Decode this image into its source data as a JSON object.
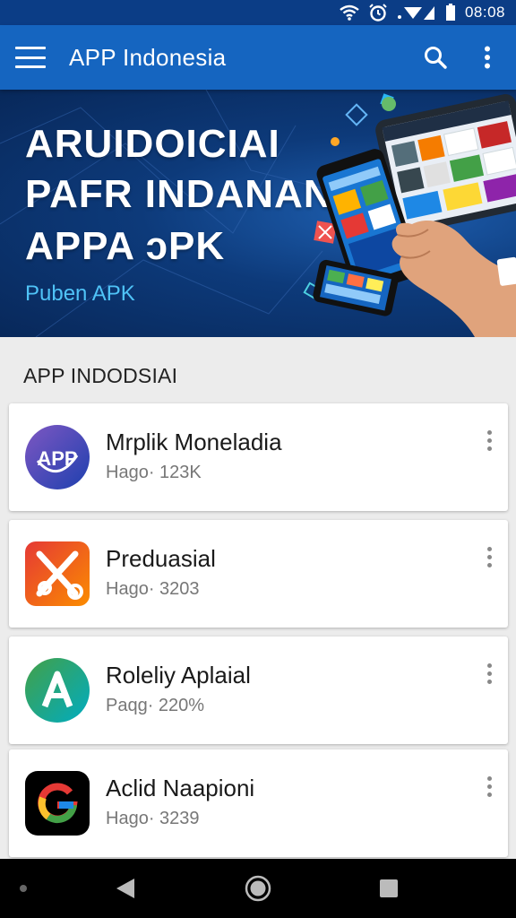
{
  "status_bar": {
    "time": "08:08",
    "icons": [
      "wifi-icon",
      "alarm-icon",
      "signal-icon",
      "battery-icon"
    ]
  },
  "app_bar": {
    "title": "APP  Indonesia",
    "icons": [
      "menu-icon",
      "search-icon",
      "more-vert-icon"
    ],
    "color": "#1565c0"
  },
  "banner": {
    "line1": "ARUIDOICIAI",
    "line2": "PAFR INDANAN",
    "line3": "APPA ɔPK",
    "subtitle": "Puben APK"
  },
  "section": {
    "title": "APP INDODSIAI"
  },
  "apps": [
    {
      "name": "Mrplik Moneladia",
      "meta": "Hago· 123K",
      "icon": "app-logo-icon"
    },
    {
      "name": "Preduasial",
      "meta": "Hago· 3203",
      "icon": "scissors-wrench-icon"
    },
    {
      "name": "Roleliy Aplaial",
      "meta": "Paqg· 220%",
      "icon": "letter-a-icon"
    },
    {
      "name": "Aclid Naapioni",
      "meta": "Hago· 3239",
      "icon": "g-logo-icon"
    }
  ],
  "nav_bar": {
    "icons": [
      "dot-icon",
      "back-icon",
      "home-icon",
      "recents-icon"
    ]
  }
}
